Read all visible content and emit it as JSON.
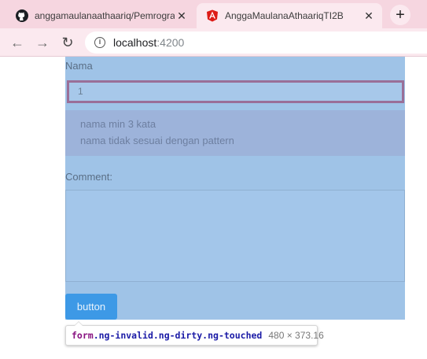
{
  "browser": {
    "tabs": [
      {
        "title": "anggamaulanaathaariq/Pemrogra",
        "icon": "github-icon",
        "close": "✕"
      },
      {
        "title": "AnggaMaulanaAthaariqTI2B",
        "icon": "angular-icon",
        "close": "✕"
      }
    ],
    "new_tab": "+",
    "url_host": "localhost",
    "url_port": ":4200"
  },
  "form": {
    "nama_label": "Nama",
    "nama_value": "1",
    "errors": [
      "nama min 3 kata",
      "nama tidak sesuai dengan pattern"
    ],
    "comment_label": "Comment:",
    "comment_value": "",
    "submit_label": "button"
  },
  "inspector": {
    "tag": "form",
    "classes": ".ng-invalid.ng-dirty.ng-touched",
    "dimensions": "480 × 373.16"
  },
  "colors": {
    "highlight": "#9fc3e7",
    "error_bg": "#9db3da",
    "button": "#3d99e6",
    "focus_border": "#9a6f98"
  }
}
